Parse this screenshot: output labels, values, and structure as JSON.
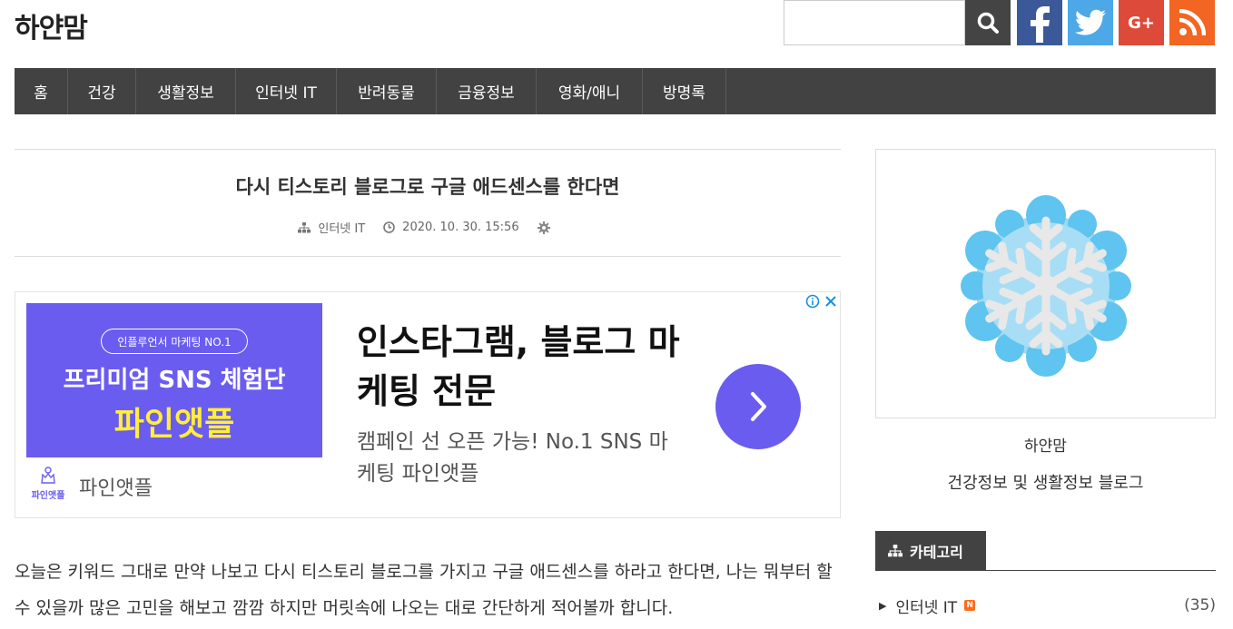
{
  "site": {
    "title": "하얀맘"
  },
  "search": {
    "placeholder": ""
  },
  "social": {
    "facebook": "f",
    "googleplus": "G+"
  },
  "nav": {
    "items": [
      {
        "label": "홈"
      },
      {
        "label": "건강"
      },
      {
        "label": "생활정보"
      },
      {
        "label": "인터넷 IT"
      },
      {
        "label": "반려동물"
      },
      {
        "label": "금융정보"
      },
      {
        "label": "영화/애니"
      },
      {
        "label": "방명록"
      }
    ]
  },
  "post": {
    "title": "다시 티스토리 블로그로 구글 애드센스를 한다면",
    "category": "인터넷 IT",
    "date": "2020. 10. 30. 15:56",
    "body": "오늘은 키워드 그대로 만약 나보고 다시 티스토리 블로그를 가지고 구글 애드센스를 하라고 한다면, 나는 뭐부터 할수 있을까 많은 고민을 해보고 깜깜 하지만 머릿속에 나오는 대로 간단하게 적어볼까 합니다."
  },
  "ad": {
    "pill": "인플루언서 마케팅 NO.1",
    "image_line1": "프리미엄 SNS 체험단",
    "image_line2": "파인앳플",
    "brand_icon_text": "파인앳플",
    "brand": "파인앳플",
    "headline": "인스타그램, 블로그 마케팅 전문",
    "description": "캠페인 선 오픈 가능! No.1 SNS 마케팅 파인앳플",
    "accent_color": "#6b5cf0"
  },
  "sidebar": {
    "profile_name": "하얀맘",
    "profile_desc": "건강정보 및 생활정보 블로그",
    "category_header": "카테고리",
    "categories": [
      {
        "label": "인터넷 IT",
        "badge": "N",
        "count": "(35)"
      }
    ]
  },
  "colors": {
    "nav_bg": "#424242",
    "facebook": "#3b5998",
    "twitter": "#4ca8e6",
    "googleplus": "#de4a3a",
    "rss": "#f26522"
  }
}
